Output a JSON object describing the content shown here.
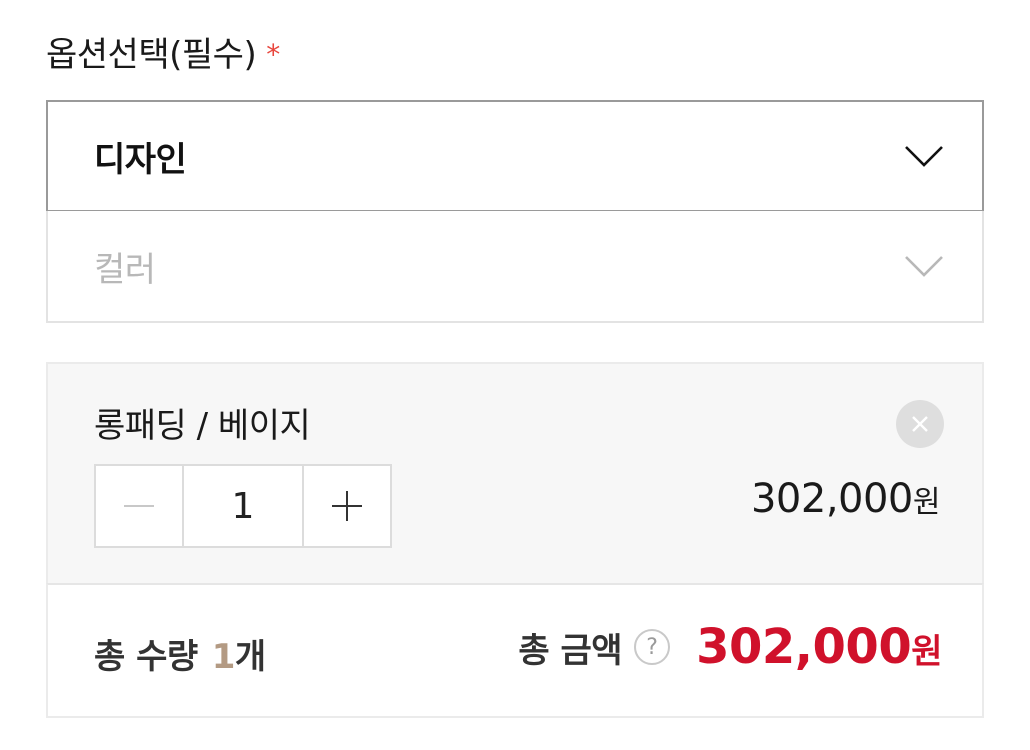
{
  "options": {
    "title": "옵션선택(필수)",
    "required_mark": "*",
    "design_select": {
      "value": "디자인"
    },
    "color_select": {
      "placeholder": "컬러"
    }
  },
  "selected_item": {
    "name": "롱패딩 / 베이지",
    "quantity": "1",
    "price": "302,000",
    "currency": "원"
  },
  "summary": {
    "qty_label": "총 수량",
    "qty_value": "1",
    "qty_unit": "개",
    "amount_label": "총 금액",
    "help_symbol": "?",
    "amount_value": "302,000",
    "currency": "원"
  },
  "colors": {
    "accent_red": "#d0112b",
    "required_red": "#e8463d",
    "qty_highlight": "#b39a83"
  }
}
